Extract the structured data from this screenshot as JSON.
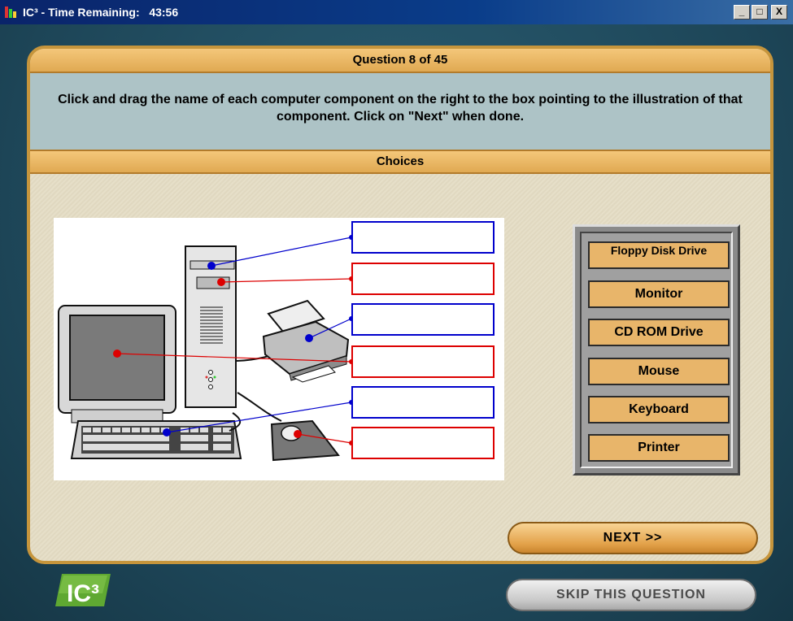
{
  "window": {
    "title": "IC³ - Time Remaining:   43:56",
    "minimize_label": "_",
    "maximize_label": "□",
    "close_label": "X"
  },
  "question": {
    "header": "Question 8 of 45",
    "instructions": "Click and drag the name of each computer component on the right to the box pointing to the illustration of that component. Click on \"Next\" when done."
  },
  "choices_header": "Choices",
  "choices": [
    "Floppy Disk Drive",
    "Monitor",
    "CD ROM Drive",
    "Mouse",
    "Keyboard",
    "Printer"
  ],
  "drop_targets": [
    "",
    "",
    "",
    "",
    "",
    ""
  ],
  "colors": {
    "blue_marker": "#0000cc",
    "red_marker": "#dd0000",
    "accent_orange": "#e3a24a"
  },
  "buttons": {
    "next": "NEXT >>",
    "skip": "SKIP THIS QUESTION"
  },
  "logo_text": "IC³"
}
